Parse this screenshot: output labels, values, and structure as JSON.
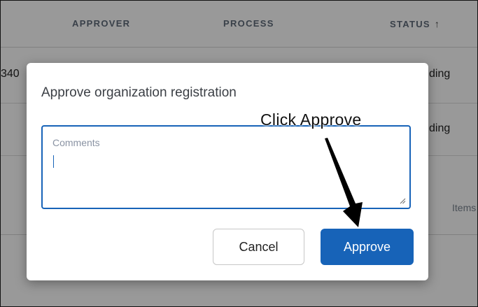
{
  "table": {
    "headers": {
      "approver": "APPROVER",
      "process": "PROCESS",
      "status": "STATUS"
    },
    "rows": [
      {
        "left_fragment": "340",
        "status_fragment": "ding"
      },
      {
        "status_fragment": "ding"
      }
    ],
    "footer": {
      "items_label": "Items"
    }
  },
  "dialog": {
    "title": "Approve organization registration",
    "comments": {
      "label": "Comments",
      "value": ""
    },
    "buttons": {
      "cancel": "Cancel",
      "approve": "Approve"
    }
  },
  "annotation": {
    "text": "Click Approve"
  },
  "colors": {
    "primary": "#1763b8",
    "overlay": "rgba(0,0,0,0.40)",
    "header_text": "#5f6b7a"
  },
  "icons": {
    "sort": "arrow-up-icon",
    "resize": "resize-handle-icon"
  }
}
